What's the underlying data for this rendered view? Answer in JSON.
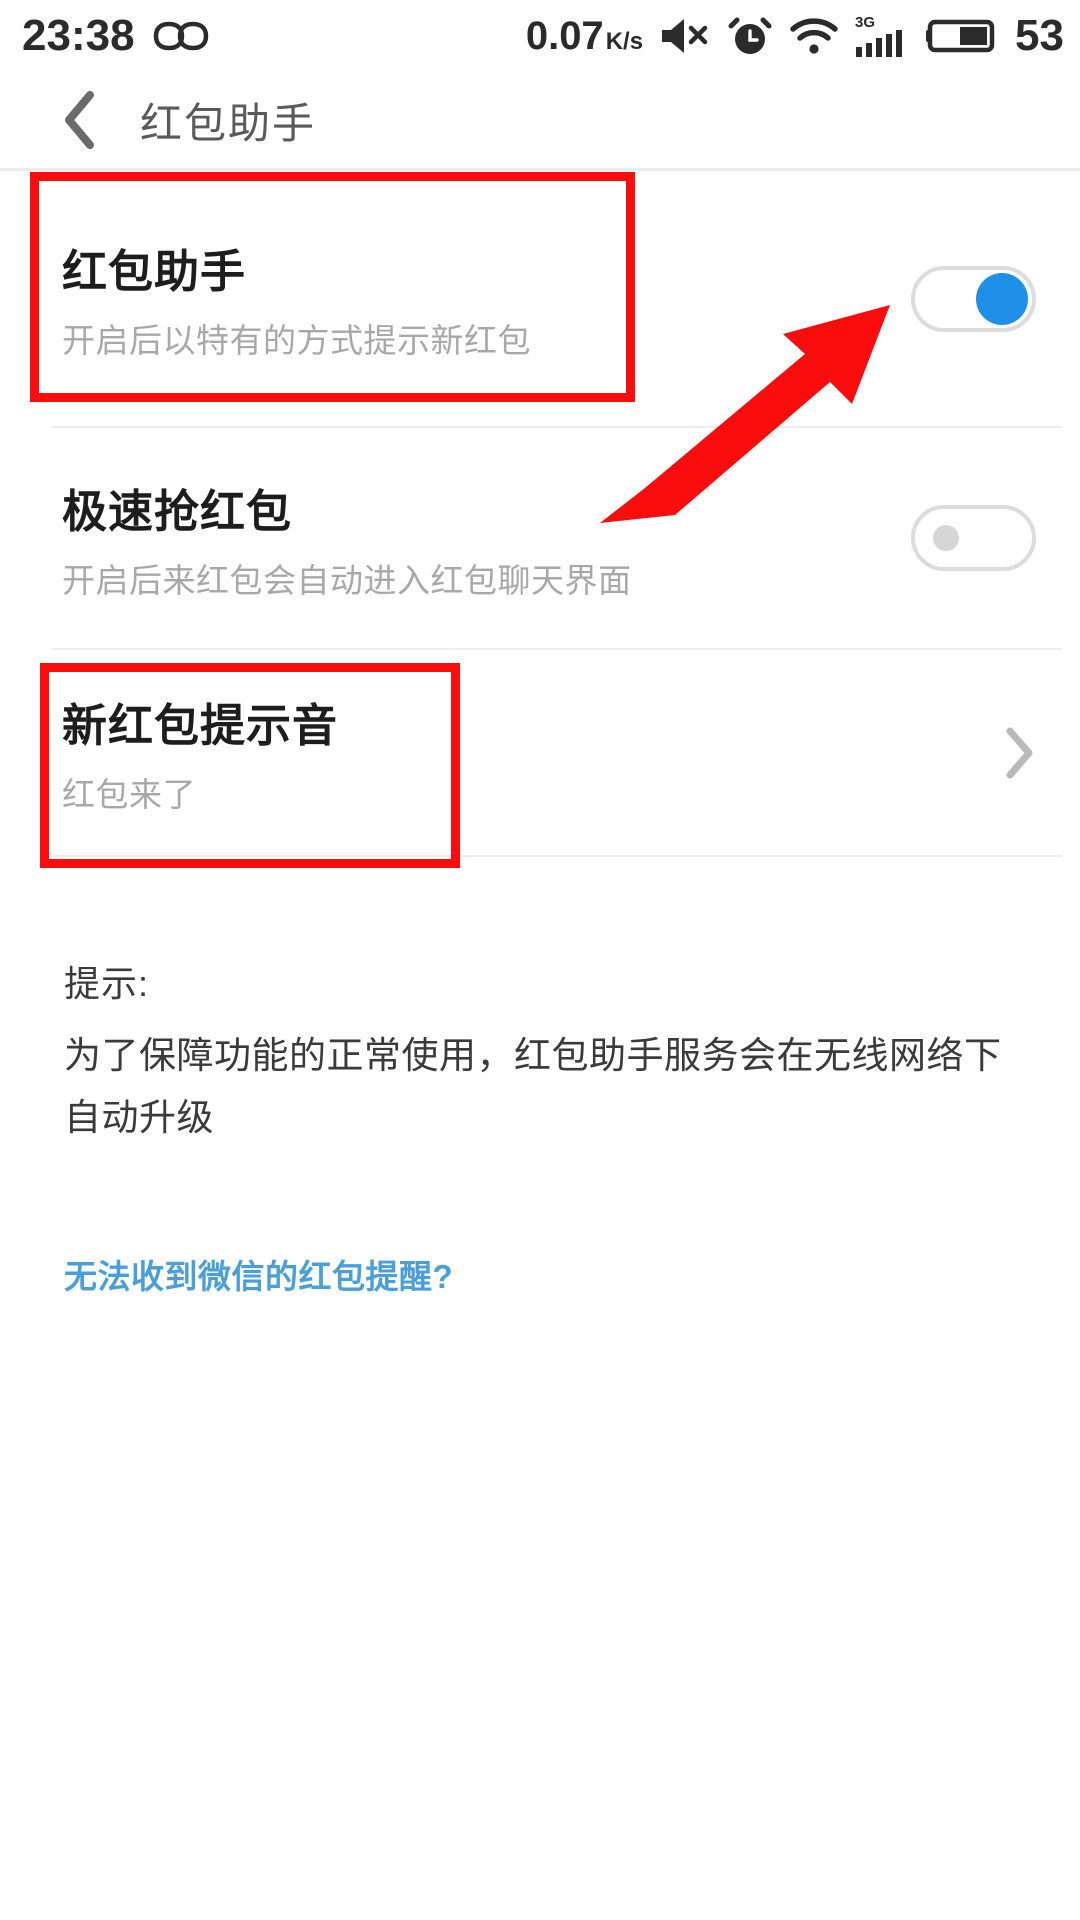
{
  "status_bar": {
    "time": "23:38",
    "infinity_icon": "infinity-icon",
    "network_speed_value": "0.07",
    "network_speed_unit": "K/s",
    "icons": [
      "mute-icon",
      "alarm-icon",
      "wifi-icon",
      "signal-3g-icon",
      "battery-icon"
    ],
    "signal_label": "3G",
    "battery_level": "53"
  },
  "header": {
    "back_icon": "back-chevron-icon",
    "title": "红包助手"
  },
  "settings": {
    "rows": [
      {
        "title": "红包助手",
        "subtitle": "开启后以特有的方式提示新红包",
        "control": "toggle",
        "state": "on"
      },
      {
        "title": "极速抢红包",
        "subtitle": "开启后来红包会自动进入红包聊天界面",
        "control": "toggle",
        "state": "off"
      },
      {
        "title": "新红包提示音",
        "subtitle": "红包来了",
        "control": "chevron",
        "state": ""
      }
    ]
  },
  "hint": {
    "label": "提示:",
    "body": "为了保障功能的正常使用，红包助手服务会在无线网络下自动升级",
    "link": "无法收到微信的红包提醒?"
  },
  "annotations": {
    "accent_color": "#fb0d0d",
    "box_1_target": "红包助手",
    "box_2_target": "新红包提示音",
    "arrow_target": "红包助手 toggle"
  },
  "colors": {
    "toggle_on": "#1f8fe8",
    "toggle_off": "#d6d6d6",
    "link": "#4a9fd8",
    "title": "#1d1d1d",
    "subtitle": "#a8a8a8"
  }
}
